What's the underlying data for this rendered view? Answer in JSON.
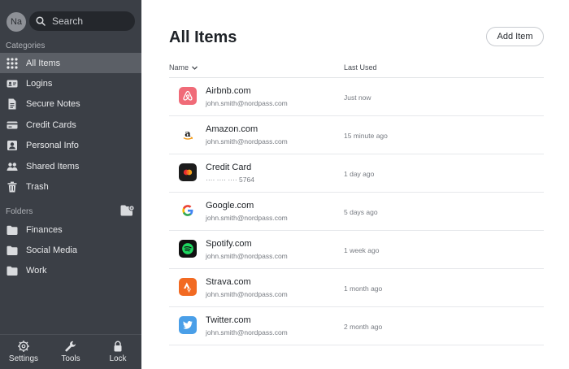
{
  "user": {
    "initials": "Na"
  },
  "search": {
    "placeholder": "Search"
  },
  "sidebar": {
    "categories_label": "Categories",
    "categories": [
      {
        "label": "All Items",
        "icon": "grid-icon",
        "active": true
      },
      {
        "label": "Logins",
        "icon": "id-card-icon"
      },
      {
        "label": "Secure Notes",
        "icon": "note-icon"
      },
      {
        "label": "Credit Cards",
        "icon": "credit-card-icon"
      },
      {
        "label": "Personal Info",
        "icon": "person-card-icon"
      },
      {
        "label": "Shared Items",
        "icon": "people-icon"
      },
      {
        "label": "Trash",
        "icon": "trash-icon"
      }
    ],
    "folders_label": "Folders",
    "folders": [
      {
        "label": "Finances",
        "icon": "folder-icon"
      },
      {
        "label": "Social Media",
        "icon": "folder-icon"
      },
      {
        "label": "Work",
        "icon": "folder-icon"
      }
    ]
  },
  "bottom": {
    "settings": "Settings",
    "tools": "Tools",
    "lock": "Lock"
  },
  "main": {
    "title": "All Items",
    "add_button": "Add Item",
    "col_name": "Name",
    "col_last_used": "Last Used",
    "items": [
      {
        "title": "Airbnb.com",
        "sub": "john.smith@nordpass.com",
        "used": "Just now",
        "icon": "airbnb-icon",
        "color": "#f06b78"
      },
      {
        "title": "Amazon.com",
        "sub": "john.smith@nordpass.com",
        "used": "15 minute ago",
        "icon": "amazon-icon",
        "color": "#ffffff"
      },
      {
        "title": "Credit Card",
        "sub": "···· ···· ···· 5764",
        "used": "1 day ago",
        "icon": "mastercard-icon",
        "color": "#1c1c1c"
      },
      {
        "title": "Google.com",
        "sub": "john.smith@nordpass.com",
        "used": "5 days ago",
        "icon": "google-icon",
        "color": "#ffffff"
      },
      {
        "title": "Spotify.com",
        "sub": "john.smith@nordpass.com",
        "used": "1 week ago",
        "icon": "spotify-icon",
        "color": "#111111"
      },
      {
        "title": "Strava.com",
        "sub": "john.smith@nordpass.com",
        "used": "1 month ago",
        "icon": "strava-icon",
        "color": "#f26a22"
      },
      {
        "title": "Twitter.com",
        "sub": "john.smith@nordpass.com",
        "used": "2 month ago",
        "icon": "twitter-icon",
        "color": "#4a9fe8"
      }
    ]
  }
}
